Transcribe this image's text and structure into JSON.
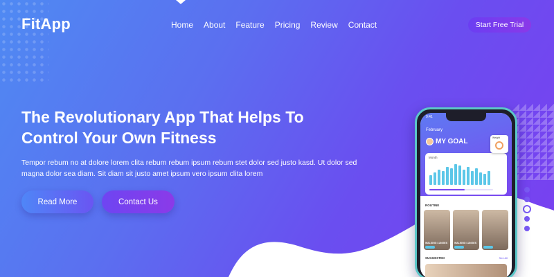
{
  "brand": {
    "name": "FitApp"
  },
  "nav": {
    "items": [
      "Home",
      "About",
      "Feature",
      "Pricing",
      "Review",
      "Contact"
    ],
    "cta": "Start Free Trial"
  },
  "hero": {
    "title": "The Revolutionary App That Helps To Control Your Own Fitness",
    "lead": "Tempor rebum no at dolore lorem clita rebum rebum ipsum rebum stet dolor sed justo kasd. Ut dolor sed magna dolor sea diam. Sit diam sit justo amet ipsum vero ipsum clita lorem",
    "primary_button": "Read More",
    "secondary_button": "Contact Us"
  },
  "pager": {
    "count": 5,
    "active_index": 2
  },
  "phone": {
    "time": "9:41",
    "month": "February",
    "goal_title": "MY GOAL",
    "month_select": "Month",
    "weight_label": "Weight",
    "routine_label": "ROUTINE",
    "see_all": "See All",
    "tiles": [
      {
        "caption": "WALKING LUNGES"
      },
      {
        "caption": "WALKING LUNGES"
      },
      {
        "caption": ""
      }
    ],
    "suggested_label": "SUGGESTED",
    "progress": 0.55,
    "bar_values": [
      14,
      18,
      22,
      20,
      26,
      24,
      30,
      28,
      22,
      26,
      20,
      24,
      18,
      16,
      20
    ]
  },
  "colors": {
    "gradient_start": "#4f8af3",
    "gradient_end": "#7a3ff0",
    "accent": "#5cc7e8"
  }
}
